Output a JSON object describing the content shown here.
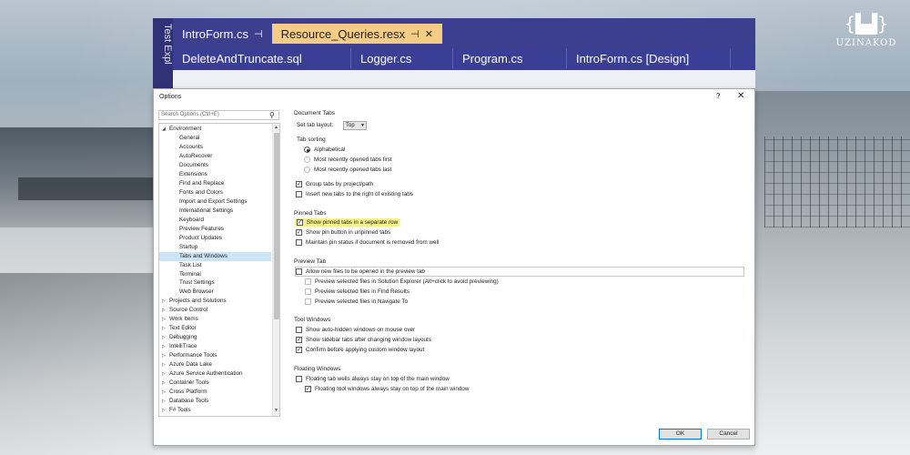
{
  "vs": {
    "side_label": "Test Expl",
    "row1": [
      {
        "label": "IntroForm.cs",
        "pin": "⊣",
        "active": false
      },
      {
        "label": "Resource_Queries.resx",
        "pin": "⊣",
        "close": "✕",
        "active": true
      }
    ],
    "row2": [
      "DeleteAndTruncate.sql",
      "Logger.cs",
      "Program.cs",
      "IntroForm.cs [Design]"
    ]
  },
  "logo": {
    "mark": "{▙▟}",
    "text": "UZINAKOD"
  },
  "dialog": {
    "title": "Options",
    "help": "?",
    "close": "✕",
    "search_placeholder": "Search Options (Ctrl+E)",
    "tree": [
      {
        "label": "Environment",
        "level": 0,
        "expanded": true
      },
      {
        "label": "General",
        "level": 1
      },
      {
        "label": "Accounts",
        "level": 1
      },
      {
        "label": "AutoRecover",
        "level": 1
      },
      {
        "label": "Documents",
        "level": 1
      },
      {
        "label": "Extensions",
        "level": 1
      },
      {
        "label": "Find and Replace",
        "level": 1
      },
      {
        "label": "Fonts and Colors",
        "level": 1
      },
      {
        "label": "Import and Export Settings",
        "level": 1
      },
      {
        "label": "International Settings",
        "level": 1
      },
      {
        "label": "Keyboard",
        "level": 1
      },
      {
        "label": "Preview Features",
        "level": 1
      },
      {
        "label": "Product Updates",
        "level": 1
      },
      {
        "label": "Startup",
        "level": 1
      },
      {
        "label": "Tabs and Windows",
        "level": 1,
        "selected": true
      },
      {
        "label": "Task List",
        "level": 1
      },
      {
        "label": "Terminal",
        "level": 1
      },
      {
        "label": "Trust Settings",
        "level": 1
      },
      {
        "label": "Web Browser",
        "level": 1
      },
      {
        "label": "Projects and Solutions",
        "level": 0
      },
      {
        "label": "Source Control",
        "level": 0
      },
      {
        "label": "Work Items",
        "level": 0
      },
      {
        "label": "Text Editor",
        "level": 0
      },
      {
        "label": "Debugging",
        "level": 0
      },
      {
        "label": "IntelliTrace",
        "level": 0
      },
      {
        "label": "Performance Tools",
        "level": 0
      },
      {
        "label": "Azure Data Lake",
        "level": 0
      },
      {
        "label": "Azure Service Authentication",
        "level": 0
      },
      {
        "label": "Container Tools",
        "level": 0
      },
      {
        "label": "Cross Platform",
        "level": 0
      },
      {
        "label": "Database Tools",
        "level": 0
      },
      {
        "label": "F# Tools",
        "level": 0
      }
    ],
    "document_tabs": {
      "heading": "Document Tabs",
      "set_tab_layout_label": "Set tab layout:",
      "set_tab_layout_value": "Top",
      "tab_sorting_label": "Tab sorting",
      "radios": [
        {
          "label": "Alphabetical",
          "checked": true
        },
        {
          "label": "Most recently opened tabs first",
          "checked": false
        },
        {
          "label": "Most recently opened tabs last",
          "checked": false
        }
      ],
      "checks": [
        {
          "label": "Group tabs by project/path",
          "checked": true
        },
        {
          "label": "Insert new tabs to the right of existing tabs",
          "checked": false
        }
      ]
    },
    "pinned_tabs": {
      "heading": "Pinned Tabs",
      "checks": [
        {
          "label": "Show pinned tabs in a separate row",
          "checked": true
        },
        {
          "label": "Show pin button in unpinned tabs",
          "checked": true
        },
        {
          "label": "Maintain pin status if document is removed from well",
          "checked": false
        }
      ]
    },
    "preview_tab": {
      "heading": "Preview Tab",
      "main": "Allow new files to be opened in the preview tab",
      "subs": [
        "Preview selected files in Solution Explorer (Alt+click to avoid previewing)",
        "Preview selected files in Find Results",
        "Preview selected files in Navigate To"
      ]
    },
    "tool_windows": {
      "heading": "Tool Windows",
      "checks": [
        {
          "label": "Show auto-hidden windows on mouse over",
          "checked": false
        },
        {
          "label": "Show sidebar tabs after changing window layouts",
          "checked": true
        },
        {
          "label": "Confirm before applying custom window layout",
          "checked": true
        }
      ]
    },
    "floating_windows": {
      "heading": "Floating Windows",
      "checks": [
        {
          "label": "Floating tab wells always stay on top of the main window",
          "checked": false
        },
        {
          "label": "Floating tool windows always stay on top of the main window",
          "checked": true
        }
      ]
    },
    "ok": "OK",
    "cancel": "Cancel"
  }
}
